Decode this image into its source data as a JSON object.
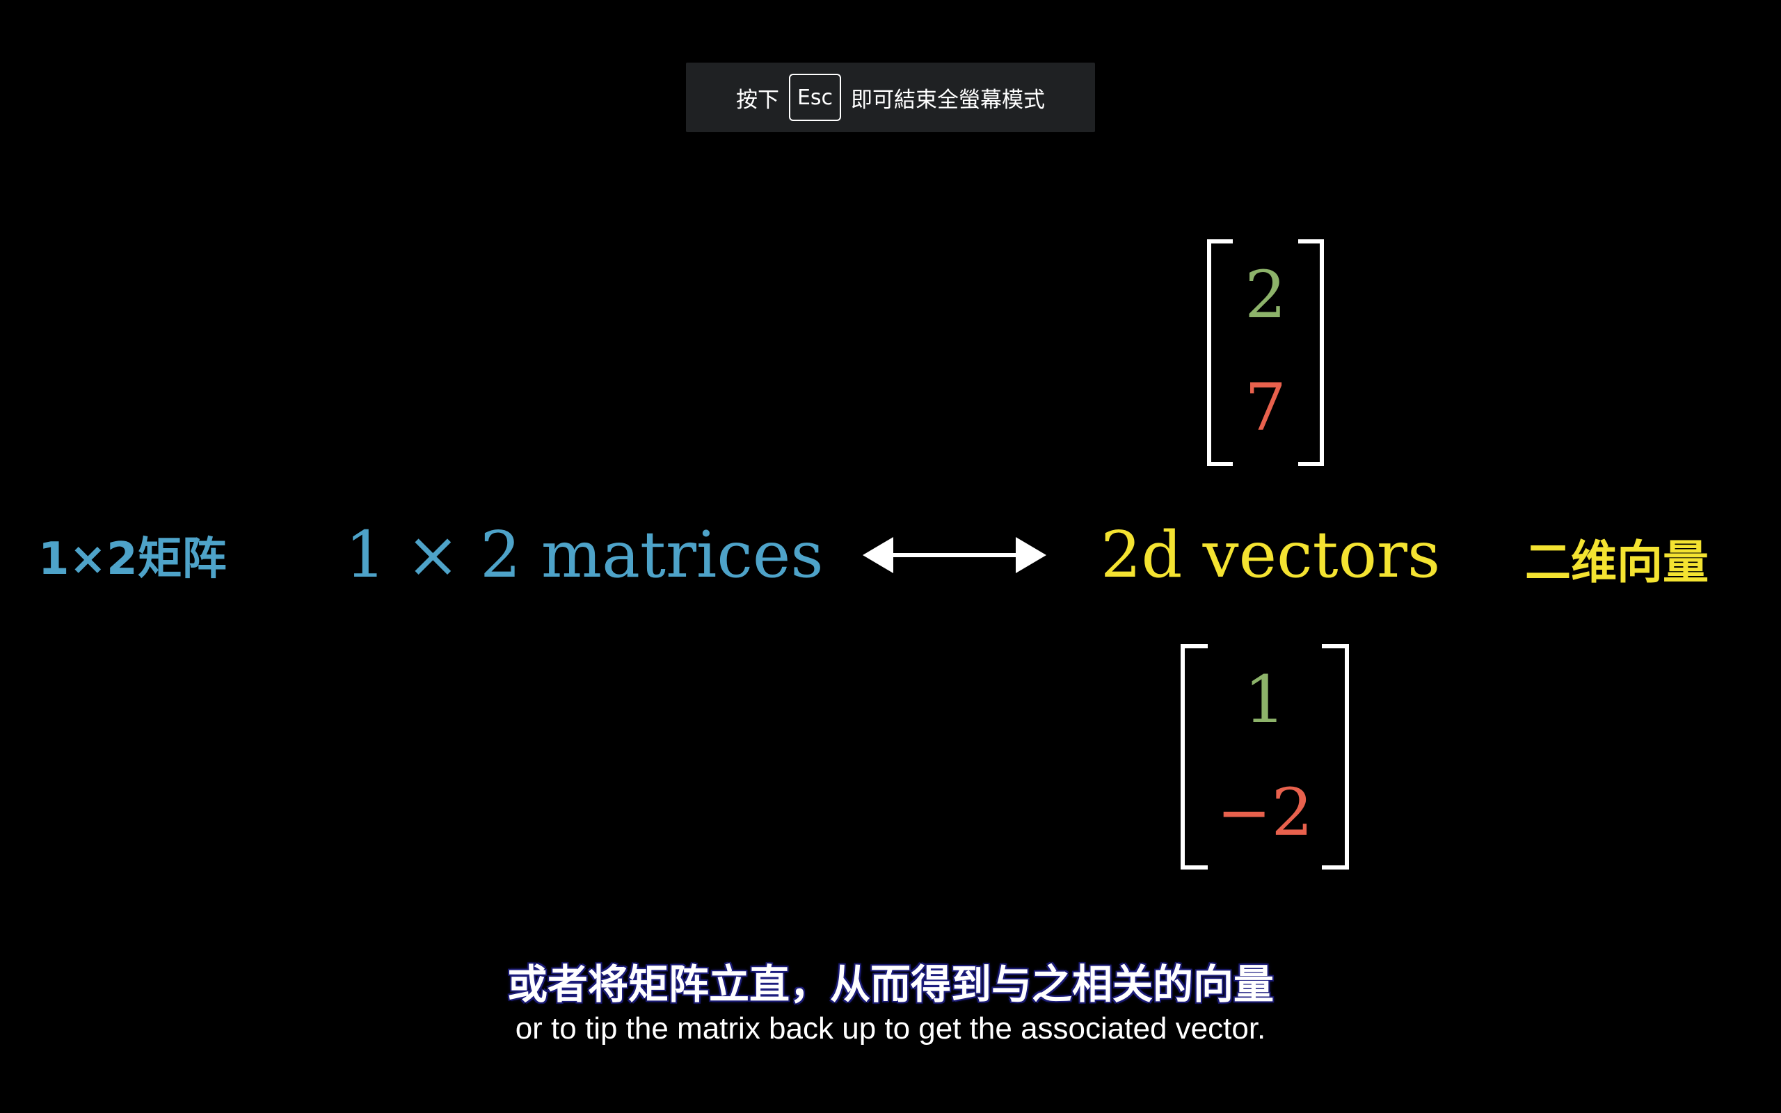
{
  "colors": {
    "blue": "#4ea3c9",
    "yellow": "#f4e331",
    "green": "#8db36a",
    "red": "#e8614d",
    "white": "#ffffff",
    "notice_bg": "#1f2123"
  },
  "fullscreen_notice": {
    "prefix": "按下",
    "key": "Esc",
    "suffix": "即可結束全螢幕模式"
  },
  "scene": {
    "left_cn_label": "1×2矩阵",
    "matrices_label": "1 × 2 matrices",
    "vectors_label": "2d vectors",
    "right_cn_label": "二维向量",
    "arrow_icon": "double-arrow-icon",
    "vector_top": [
      "2",
      "7"
    ],
    "vector_bottom": [
      "1",
      "−2"
    ]
  },
  "subtitles": {
    "chinese": "或者将矩阵立直，从而得到与之相关的向量",
    "english": "or to tip the matrix back up to get the associated vector."
  }
}
